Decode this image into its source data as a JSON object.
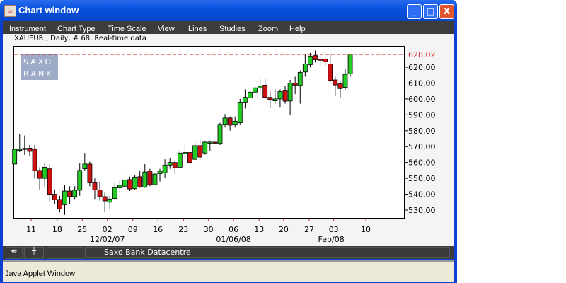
{
  "window": {
    "title": "Chart window",
    "min": "_",
    "max": "□",
    "close": "X"
  },
  "menu": [
    "Instrument",
    "Chart Type",
    "Time Scale",
    "View",
    "Lines",
    "Studies",
    "Zoom",
    "Help"
  ],
  "info": "XAUEUR , Daily, # 68, Real-time data",
  "logo": [
    "SAXO",
    "BANK"
  ],
  "status": {
    "text": "Saxo Bank Datacentre"
  },
  "applet": "Java Applet Window",
  "colors": {
    "up": "#22cc22",
    "down": "#cc1111",
    "line": "#cc2222"
  },
  "chart_data": {
    "type": "candlestick",
    "instrument": "XAUEUR",
    "ylim": [
      525,
      632
    ],
    "yticks": [
      530,
      540,
      550,
      560,
      570,
      580,
      590,
      600,
      610,
      620
    ],
    "ytick_labels": [
      "530,00",
      "540,00",
      "550,00",
      "560,00",
      "570,00",
      "580,00",
      "590,00",
      "600,00",
      "610,00",
      "620,00"
    ],
    "last_price": 628.02,
    "last_label": "628,02",
    "xticks": [
      {
        "i": 3.3,
        "label": "11"
      },
      {
        "i": 8.5,
        "label": "18"
      },
      {
        "i": 13.5,
        "label": "25"
      },
      {
        "i": 18.5,
        "label": "02"
      },
      {
        "i": 23.6,
        "label": "09"
      },
      {
        "i": 28.6,
        "label": "16"
      },
      {
        "i": 33.7,
        "label": "23"
      },
      {
        "i": 38.7,
        "label": "30"
      },
      {
        "i": 43.7,
        "label": "06"
      },
      {
        "i": 48.8,
        "label": "13"
      },
      {
        "i": 53.7,
        "label": "20"
      },
      {
        "i": 58.8,
        "label": "27"
      },
      {
        "i": 63.7,
        "label": "03"
      },
      {
        "i": 70.1,
        "label": "10"
      }
    ],
    "xlabels2": [
      {
        "i": 18.5,
        "label": "12/02/07"
      },
      {
        "i": 43.7,
        "label": "01/06/08"
      },
      {
        "i": 63.2,
        "label": "Feb/08"
      }
    ],
    "ohlc": [
      [
        559,
        568.3,
        559,
        568.3
      ],
      [
        567.6,
        578,
        566.5,
        568.3
      ],
      [
        568.7,
        577,
        564.8,
        568.9
      ],
      [
        569,
        571,
        564,
        567
      ],
      [
        568.3,
        571,
        549.8,
        554.7
      ],
      [
        555,
        557,
        543,
        550
      ],
      [
        550,
        560,
        545,
        557
      ],
      [
        556,
        559,
        535,
        540
      ],
      [
        540,
        543,
        534,
        536.5
      ],
      [
        536.7,
        539,
        528.5,
        530.7
      ],
      [
        533.4,
        546,
        527,
        542
      ],
      [
        542,
        545,
        534,
        538.5
      ],
      [
        538.5,
        545,
        537,
        542.5
      ],
      [
        542.5,
        559.5,
        539,
        555
      ],
      [
        556,
        566,
        555,
        559
      ],
      [
        559,
        560.5,
        545,
        547.6
      ],
      [
        547.6,
        550,
        537,
        542.7
      ],
      [
        542.7,
        548,
        536,
        538.5
      ],
      [
        538.5,
        541,
        529,
        535.8
      ],
      [
        535,
        539,
        531,
        537
      ],
      [
        537.3,
        547,
        537,
        544
      ],
      [
        544,
        549,
        541,
        545.6
      ],
      [
        545,
        553,
        542,
        549
      ],
      [
        549.2,
        551,
        542,
        543.3
      ],
      [
        543.5,
        552,
        543,
        550.8
      ],
      [
        551,
        555,
        544,
        544.5
      ],
      [
        544.4,
        559,
        544,
        554
      ],
      [
        554.6,
        556,
        545,
        546
      ],
      [
        546,
        553,
        546,
        552.7
      ],
      [
        553,
        556,
        548,
        554.5
      ],
      [
        553.5,
        562,
        550,
        558.4
      ],
      [
        558.4,
        563,
        556,
        560
      ],
      [
        560,
        561,
        553,
        556.7
      ],
      [
        557,
        568,
        557,
        566
      ],
      [
        566,
        571,
        563,
        566.3
      ],
      [
        566.3,
        566.5,
        558,
        560
      ],
      [
        562,
        573,
        561,
        570.6
      ],
      [
        570.6,
        574,
        562,
        563.4
      ],
      [
        566,
        573.5,
        565,
        572.8
      ],
      [
        572.6,
        573.8,
        567,
        572.8
      ],
      [
        572.8,
        573,
        572.3,
        572.5
      ],
      [
        572,
        585,
        571,
        584
      ],
      [
        584,
        590.5,
        582,
        588
      ],
      [
        588,
        589,
        580,
        583.5
      ],
      [
        584,
        589,
        582,
        586
      ],
      [
        585,
        600,
        584,
        598
      ],
      [
        598,
        606,
        594,
        601
      ],
      [
        600.6,
        606,
        592,
        604.3
      ],
      [
        604.3,
        608,
        601,
        607
      ],
      [
        607,
        613,
        603,
        608
      ],
      [
        608.7,
        613,
        600,
        601
      ],
      [
        601,
        605,
        594,
        599.6
      ],
      [
        598.8,
        606,
        597,
        600
      ],
      [
        600,
        606,
        595,
        604.6
      ],
      [
        605.5,
        608,
        597,
        598.6
      ],
      [
        598.7,
        612,
        590,
        610
      ],
      [
        610,
        614,
        603,
        608.7
      ],
      [
        608.5,
        618,
        597,
        616.7
      ],
      [
        617,
        628,
        614,
        622
      ],
      [
        621.6,
        629,
        620,
        627
      ],
      [
        627.3,
        630.5,
        623,
        624.7
      ],
      [
        625,
        628,
        620,
        624.8
      ],
      [
        625.2,
        626,
        621,
        623.4
      ],
      [
        622,
        628.5,
        610,
        611.6
      ],
      [
        612,
        614,
        602,
        608.8
      ],
      [
        609.5,
        611,
        601,
        606.5
      ],
      [
        607.3,
        619,
        606,
        615.5
      ],
      [
        615.8,
        628.02,
        614,
        628.02
      ]
    ]
  }
}
